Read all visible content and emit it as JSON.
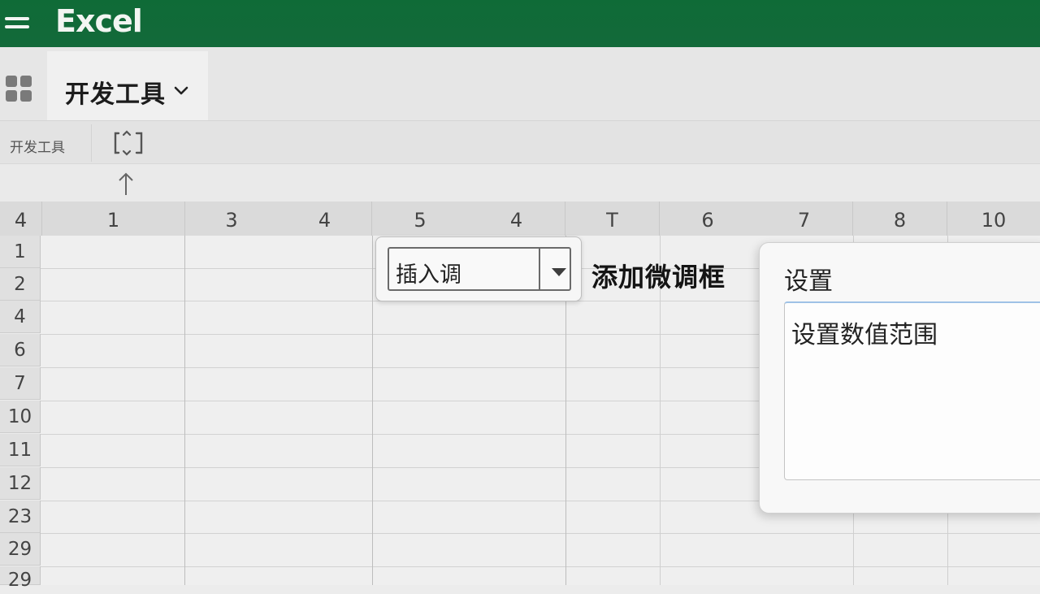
{
  "app": {
    "title": "Excel"
  },
  "ribbon": {
    "active_tab": "开发工具",
    "group_label": "开发工具"
  },
  "grid": {
    "corner": "4",
    "columns": [
      "1",
      "3",
      "4",
      "5",
      "4",
      "T",
      "6",
      "7",
      "8",
      "10"
    ],
    "rows": [
      "1",
      "2",
      "4",
      "6",
      "7",
      "10",
      "11",
      "12",
      "23",
      "29",
      "29"
    ]
  },
  "spinner_widget": {
    "text": "插入调",
    "callout": "添加微调框"
  },
  "settings_panel": {
    "title": "设置",
    "field_value": "设置数值范围"
  },
  "colors": {
    "titlebar": "#136a3a",
    "title_text": "#f2f5f2",
    "focus_border": "#9fc2e6"
  },
  "icons": [
    "hamburger-menu-icon",
    "app-launcher-icon",
    "chevron-down-icon",
    "spinner-control-icon",
    "up-arrow-icon",
    "dropdown-arrow-icon"
  ]
}
